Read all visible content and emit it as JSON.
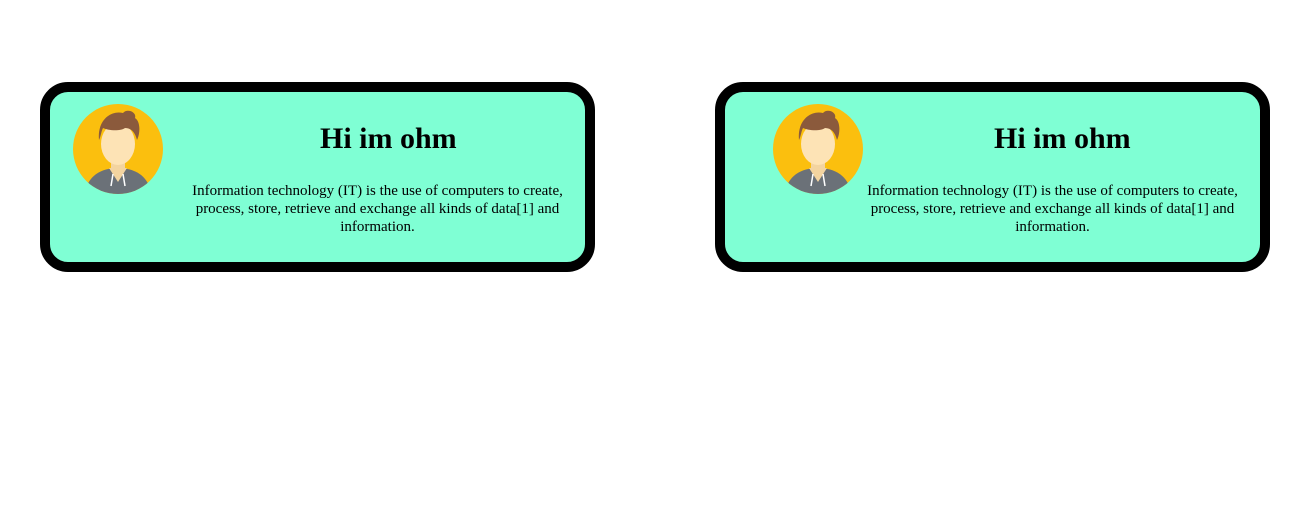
{
  "cards": [
    {
      "avatar_icon": "user-avatar-icon",
      "title": "Hi im ohm",
      "description": "Information technology (IT) is the use of computers to create, process, store, retrieve and exchange all kinds of data[1] and information."
    },
    {
      "avatar_icon": "user-avatar-icon",
      "title": "Hi im ohm",
      "description": "Information technology (IT) is the use of computers to create, process, store, retrieve and exchange all kinds of data[1] and information."
    }
  ],
  "colors": {
    "card_background": "#7fffd4",
    "card_border": "#000000",
    "avatar_background": "#fbbf0e",
    "hair": "#8b5a3c",
    "skin": "#fde3b5",
    "hoodie": "#6b7178"
  }
}
